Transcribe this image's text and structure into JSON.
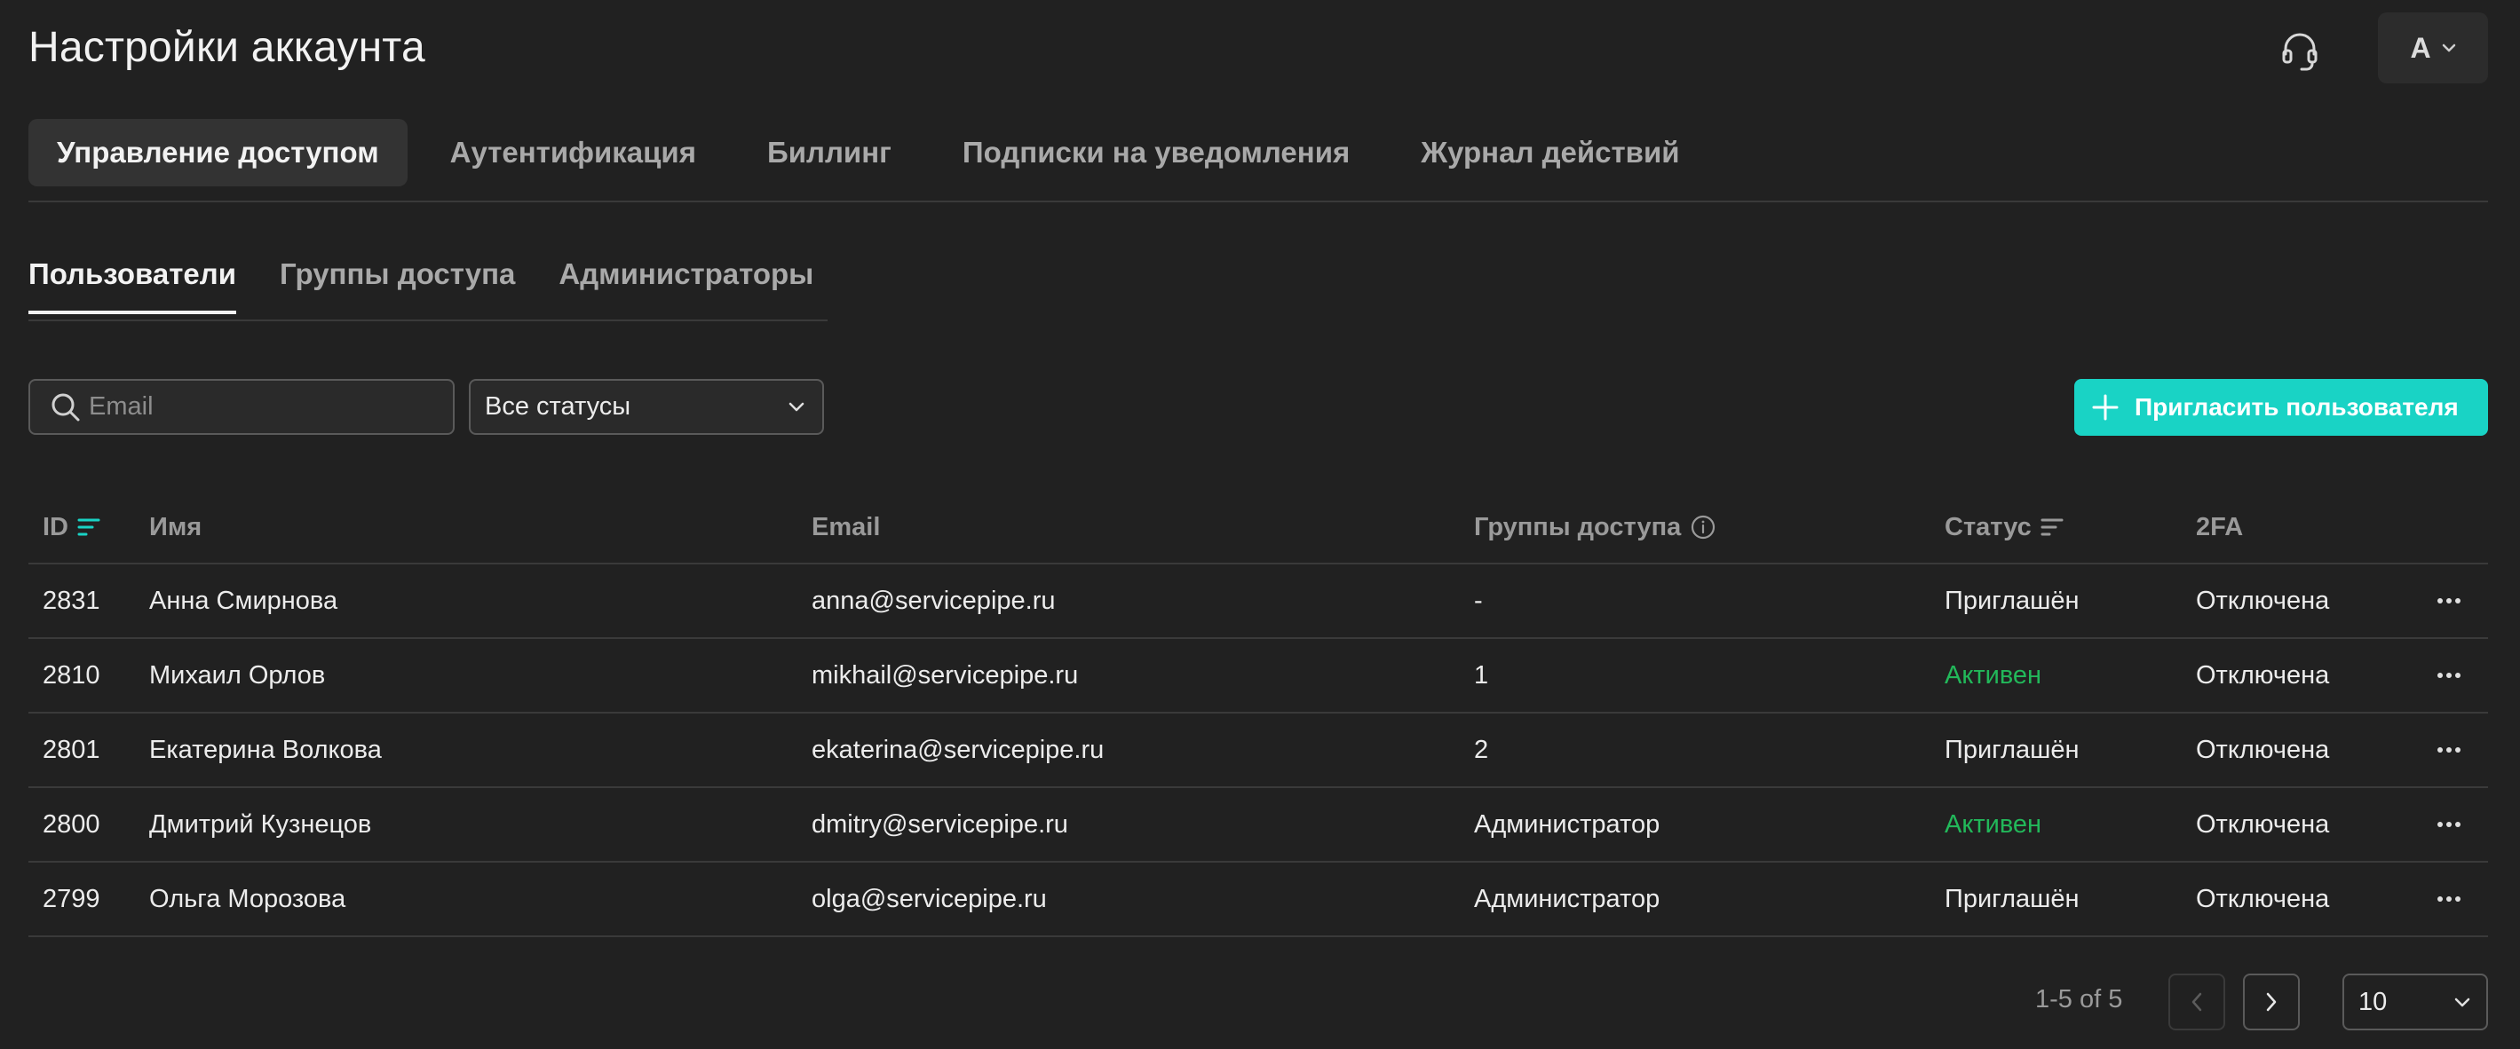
{
  "header": {
    "title": "Настройки аккаунта",
    "support_icon": "headset-icon",
    "avatar_letter": "A"
  },
  "main_tabs": [
    {
      "label": "Управление доступом",
      "active": true
    },
    {
      "label": "Аутентификация"
    },
    {
      "label": "Биллинг"
    },
    {
      "label": "Подписки на уведомления"
    },
    {
      "label": "Журнал действий"
    }
  ],
  "sub_tabs": [
    {
      "label": "Пользователи",
      "active": true
    },
    {
      "label": "Группы доступа"
    },
    {
      "label": "Администраторы"
    }
  ],
  "filters": {
    "search_placeholder": "Email",
    "search_value": "",
    "status_selected": "Все статусы"
  },
  "invite_button": "Пригласить пользователя",
  "colors": {
    "accent": "#19d3c5",
    "active_status": "#22b85a",
    "background": "#212121"
  },
  "table": {
    "columns": {
      "id": "ID",
      "name": "Имя",
      "email": "Email",
      "groups": "Группы доступа",
      "status": "Статус",
      "twofa": "2FA"
    },
    "rows": [
      {
        "id": "2831",
        "name": "Анна Смирнова",
        "email": "anna@servicepipe.ru",
        "groups": "-",
        "status": "Приглашён",
        "twofa": "Отключена"
      },
      {
        "id": "2810",
        "name": "Михаил Орлов",
        "email": "mikhail@servicepipe.ru",
        "groups": "1",
        "status": "Активен",
        "twofa": "Отключена"
      },
      {
        "id": "2801",
        "name": "Екатерина Волкова",
        "email": "ekaterina@servicepipe.ru",
        "groups": "2",
        "status": "Приглашён",
        "twofa": "Отключена"
      },
      {
        "id": "2800",
        "name": "Дмитрий Кузнецов",
        "email": "dmitry@servicepipe.ru",
        "groups": "Администратор",
        "status": "Активен",
        "twofa": "Отключена"
      },
      {
        "id": "2799",
        "name": "Ольга Морозова",
        "email": "olga@servicepipe.ru",
        "groups": "Администратор",
        "status": "Приглашён",
        "twofa": "Отключена"
      }
    ]
  },
  "pagination": {
    "info": "1-5 of 5",
    "page_size": "10"
  }
}
